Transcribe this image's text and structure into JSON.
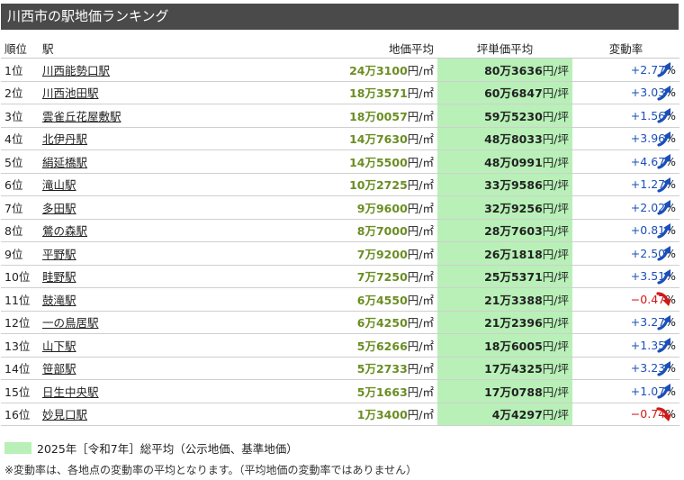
{
  "title": "川西市の駅地価ランキング",
  "headers": {
    "rank": "順位",
    "name": "駅",
    "price": "地価平均",
    "tsubo": "坪単価平均",
    "change": "変動率"
  },
  "colors": {
    "titlebar": "#4a4a4a",
    "highlight": "#b8f0b8",
    "price_text": "#6b8e23",
    "positive": "#1b4fb8",
    "negative": "#d01818"
  },
  "rows": [
    {
      "rank": "1位",
      "name": "川西能勢口駅",
      "price": "24万3100",
      "price_unit": "円/㎡",
      "tsubo": "80万3636",
      "tsubo_unit": "円/坪",
      "change": "+2.77",
      "pct": "%",
      "trend": "up"
    },
    {
      "rank": "2位",
      "name": "川西池田駅",
      "price": "18万3571",
      "price_unit": "円/㎡",
      "tsubo": "60万6847",
      "tsubo_unit": "円/坪",
      "change": "+3.03",
      "pct": "%",
      "trend": "up"
    },
    {
      "rank": "3位",
      "name": "雲雀丘花屋敷駅",
      "price": "18万0057",
      "price_unit": "円/㎡",
      "tsubo": "59万5230",
      "tsubo_unit": "円/坪",
      "change": "+1.56",
      "pct": "%",
      "trend": "up"
    },
    {
      "rank": "4位",
      "name": "北伊丹駅",
      "price": "14万7630",
      "price_unit": "円/㎡",
      "tsubo": "48万8033",
      "tsubo_unit": "円/坪",
      "change": "+3.96",
      "pct": "%",
      "trend": "up"
    },
    {
      "rank": "5位",
      "name": "絹延橋駅",
      "price": "14万5500",
      "price_unit": "円/㎡",
      "tsubo": "48万0991",
      "tsubo_unit": "円/坪",
      "change": "+4.67",
      "pct": "%",
      "trend": "up"
    },
    {
      "rank": "6位",
      "name": "滝山駅",
      "price": "10万2725",
      "price_unit": "円/㎡",
      "tsubo": "33万9586",
      "tsubo_unit": "円/坪",
      "change": "+1.27",
      "pct": "%",
      "trend": "up"
    },
    {
      "rank": "7位",
      "name": "多田駅",
      "price": "9万9600",
      "price_unit": "円/㎡",
      "tsubo": "32万9256",
      "tsubo_unit": "円/坪",
      "change": "+2.02",
      "pct": "%",
      "trend": "up"
    },
    {
      "rank": "8位",
      "name": "鶯の森駅",
      "price": "8万7000",
      "price_unit": "円/㎡",
      "tsubo": "28万7603",
      "tsubo_unit": "円/坪",
      "change": "+0.81",
      "pct": "%",
      "trend": "up"
    },
    {
      "rank": "9位",
      "name": "平野駅",
      "price": "7万9200",
      "price_unit": "円/㎡",
      "tsubo": "26万1818",
      "tsubo_unit": "円/坪",
      "change": "+2.50",
      "pct": "%",
      "trend": "up"
    },
    {
      "rank": "10位",
      "name": "畦野駅",
      "price": "7万7250",
      "price_unit": "円/㎡",
      "tsubo": "25万5371",
      "tsubo_unit": "円/坪",
      "change": "+3.51",
      "pct": "%",
      "trend": "up"
    },
    {
      "rank": "11位",
      "name": "鼓滝駅",
      "price": "6万4550",
      "price_unit": "円/㎡",
      "tsubo": "21万3388",
      "tsubo_unit": "円/坪",
      "change": "−0.47",
      "pct": "%",
      "trend": "down"
    },
    {
      "rank": "12位",
      "name": "一の鳥居駅",
      "price": "6万4250",
      "price_unit": "円/㎡",
      "tsubo": "21万2396",
      "tsubo_unit": "円/坪",
      "change": "+3.27",
      "pct": "%",
      "trend": "up"
    },
    {
      "rank": "13位",
      "name": "山下駅",
      "price": "5万6266",
      "price_unit": "円/㎡",
      "tsubo": "18万6005",
      "tsubo_unit": "円/坪",
      "change": "+1.35",
      "pct": "%",
      "trend": "up"
    },
    {
      "rank": "14位",
      "name": "笹部駅",
      "price": "5万2733",
      "price_unit": "円/㎡",
      "tsubo": "17万4325",
      "tsubo_unit": "円/坪",
      "change": "+3.23",
      "pct": "%",
      "trend": "up"
    },
    {
      "rank": "15位",
      "name": "日生中央駅",
      "price": "5万1663",
      "price_unit": "円/㎡",
      "tsubo": "17万0788",
      "tsubo_unit": "円/坪",
      "change": "+1.07",
      "pct": "%",
      "trend": "up"
    },
    {
      "rank": "16位",
      "name": "妙見口駅",
      "price": "1万3400",
      "price_unit": "円/㎡",
      "tsubo": "4万4297",
      "tsubo_unit": "円/坪",
      "change": "−0.74",
      "pct": "%",
      "trend": "down"
    }
  ],
  "legend": "2025年［令和7年］総平均（公示地価、基準地価）",
  "note": "※変動率は、各地点の変動率の平均となります。（平均地価の変動率ではありません）"
}
